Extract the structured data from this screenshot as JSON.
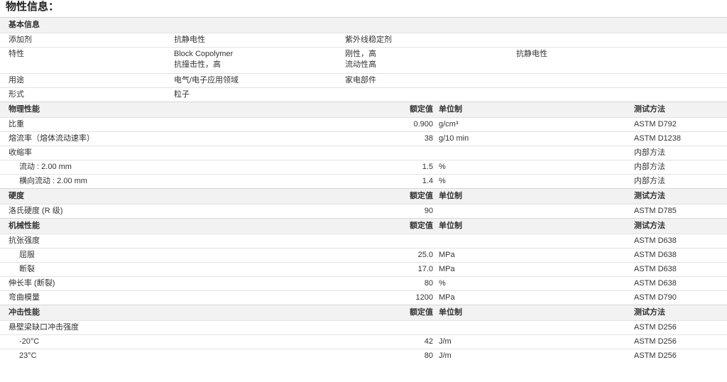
{
  "page_title": "物性信息：",
  "basic": {
    "header": "基本信息",
    "rows": [
      {
        "label": "添加剂",
        "v1": "抗静电性",
        "v2": "紫外线稳定剂",
        "v3": ""
      },
      {
        "label": "特性",
        "v1a": "Block Copolymer",
        "v1b": "抗撞击性，高",
        "v2a": "刚性，高",
        "v2b": "流动性高",
        "v3": "抗静电性"
      },
      {
        "label": "用途",
        "v1": "电气/电子应用领域",
        "v2": "家电部件",
        "v3": ""
      },
      {
        "label": "形式",
        "v1": "粒子",
        "v2": "",
        "v3": ""
      }
    ]
  },
  "sections": [
    {
      "title": "物理性能",
      "col_value": "额定值",
      "col_unit": "单位制",
      "col_method": "测试方法",
      "rows": [
        {
          "label": "比重",
          "value": "0.900",
          "unit": "g/cm³",
          "method": "ASTM D792"
        },
        {
          "label": "熔流率（熔体流动速率）",
          "value": "38",
          "unit": "g/10 min",
          "method": "ASTM D1238"
        },
        {
          "label": "收缩率",
          "value": "",
          "unit": "",
          "method": "内部方法"
        },
        {
          "label": "流动 : 2.00 mm",
          "value": "1.5",
          "unit": "%",
          "method": "内部方法"
        },
        {
          "label": "横向流动 : 2.00 mm",
          "value": "1.4",
          "unit": "%",
          "method": "内部方法"
        }
      ]
    },
    {
      "title": "硬度",
      "col_value": "额定值",
      "col_unit": "单位制",
      "col_method": "测试方法",
      "rows": [
        {
          "label": "洛氏硬度 (R 级)",
          "value": "90",
          "unit": "",
          "method": "ASTM D785"
        }
      ]
    },
    {
      "title": "机械性能",
      "col_value": "额定值",
      "col_unit": "单位制",
      "col_method": "测试方法",
      "rows": [
        {
          "label": "抗张强度",
          "value": "",
          "unit": "",
          "method": "ASTM D638"
        },
        {
          "label": "屈服",
          "value": "25.0",
          "unit": "MPa",
          "method": "ASTM D638"
        },
        {
          "label": "断裂",
          "value": "17.0",
          "unit": "MPa",
          "method": "ASTM D638"
        },
        {
          "label": "伸长率 (断裂)",
          "value": "80",
          "unit": "%",
          "method": "ASTM D638"
        },
        {
          "label": "弯曲模量",
          "value": "1200",
          "unit": "MPa",
          "method": "ASTM D790"
        }
      ]
    },
    {
      "title": "冲击性能",
      "col_value": "额定值",
      "col_unit": "单位制",
      "col_method": "测试方法",
      "rows": [
        {
          "label": "悬壁梁缺口冲击强度",
          "value": "",
          "unit": "",
          "method": "ASTM D256"
        },
        {
          "label": "-20°C",
          "value": "42",
          "unit": "J/m",
          "method": "ASTM D256"
        },
        {
          "label": "23°C",
          "value": "80",
          "unit": "J/m",
          "method": "ASTM D256"
        }
      ]
    }
  ]
}
